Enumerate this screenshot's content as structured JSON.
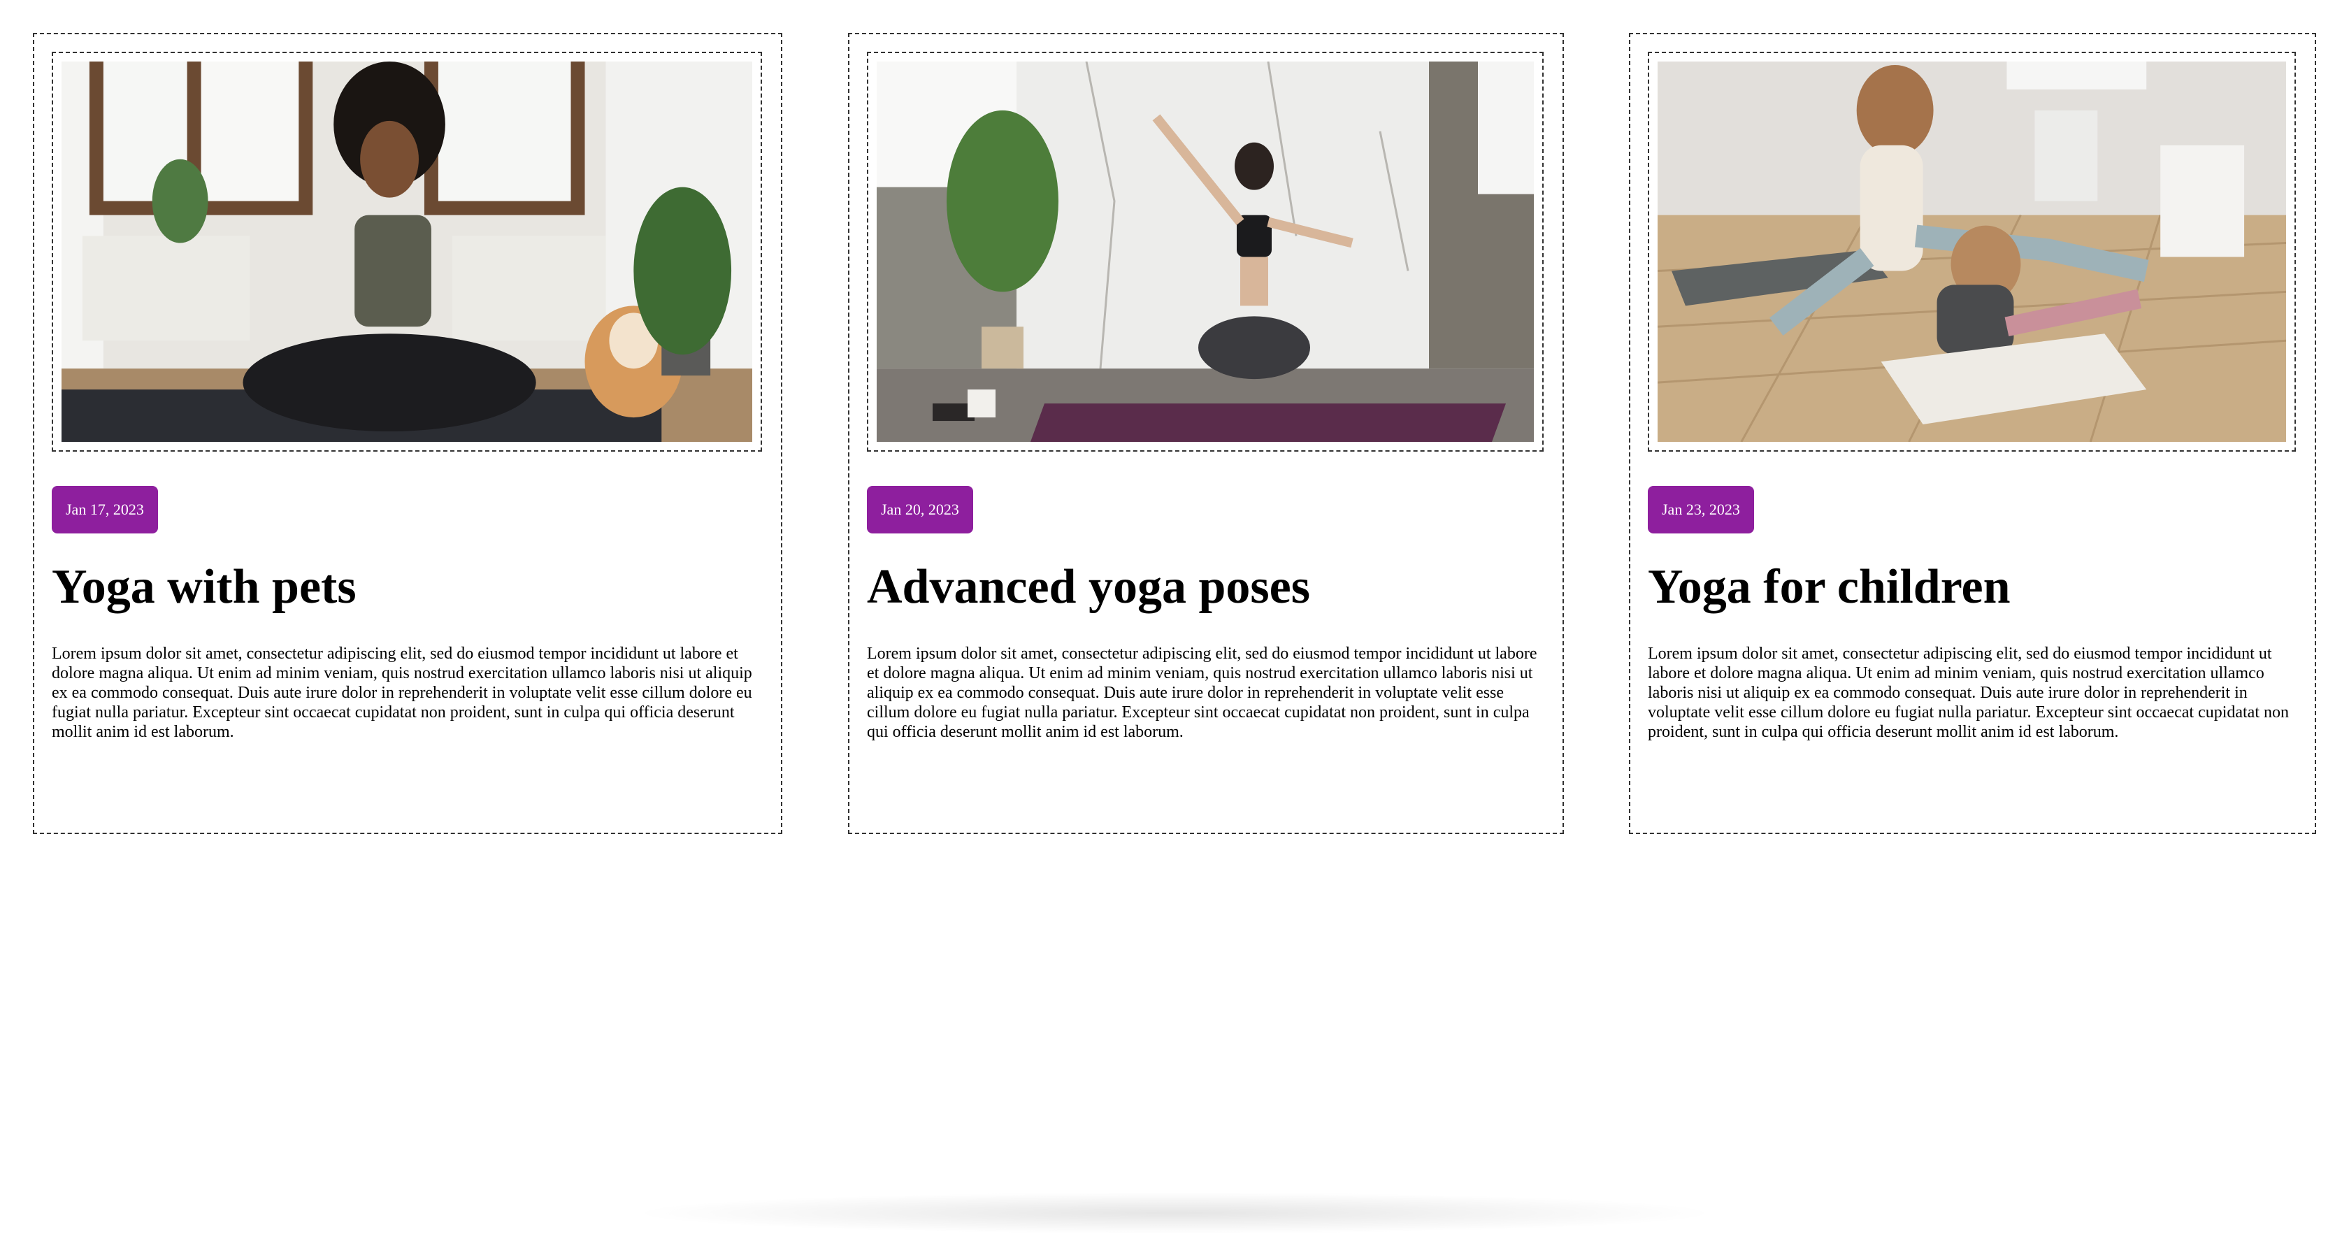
{
  "cards": [
    {
      "image_alt": "Woman meditating with a Shiba Inu dog",
      "date": "Jan 17, 2023",
      "title": "Yoga with pets",
      "body": "Lorem ipsum dolor sit amet, consectetur adipiscing elit, sed do eiusmod tempor incididunt ut labore et dolore magna aliqua. Ut enim ad minim veniam, quis nostrud exercitation ullamco laboris nisi ut aliquip ex ea commodo consequat. Duis aute irure dolor in reprehenderit in voluptate velit esse cillum dolore eu fugiat nulla pariatur. Excepteur sint occaecat cupidatat non proident, sunt in culpa qui officia deserunt mollit anim id est laborum."
    },
    {
      "image_alt": "Woman balancing in an advanced yoga pose",
      "date": "Jan 20, 2023",
      "title": "Advanced yoga poses",
      "body": "Lorem ipsum dolor sit amet, consectetur adipiscing elit, sed do eiusmod tempor incididunt ut labore et dolore magna aliqua. Ut enim ad minim veniam, quis nostrud exercitation ullamco laboris nisi ut aliquip ex ea commodo consequat. Duis aute irure dolor in reprehenderit in voluptate velit esse cillum dolore eu fugiat nulla pariatur. Excepteur sint occaecat cupidatat non proident, sunt in culpa qui officia deserunt mollit anim id est laborum."
    },
    {
      "image_alt": "Mother and child doing yoga on a wooden floor",
      "date": "Jan 23, 2023",
      "title": "Yoga for children",
      "body": "Lorem ipsum dolor sit amet, consectetur adipiscing elit, sed do eiusmod tempor incididunt ut labore et dolore magna aliqua. Ut enim ad minim veniam, quis nostrud exercitation ullamco laboris nisi ut aliquip ex ea commodo consequat. Duis aute irure dolor in reprehenderit in voluptate velit esse cillum dolore eu fugiat nulla pariatur. Excepteur sint occaecat cupidatat non proident, sunt in culpa qui officia deserunt mollit anim id est laborum."
    }
  ],
  "colors": {
    "badge_background": "#8e1f9e",
    "badge_text": "#ffffff",
    "border": "#333333"
  }
}
